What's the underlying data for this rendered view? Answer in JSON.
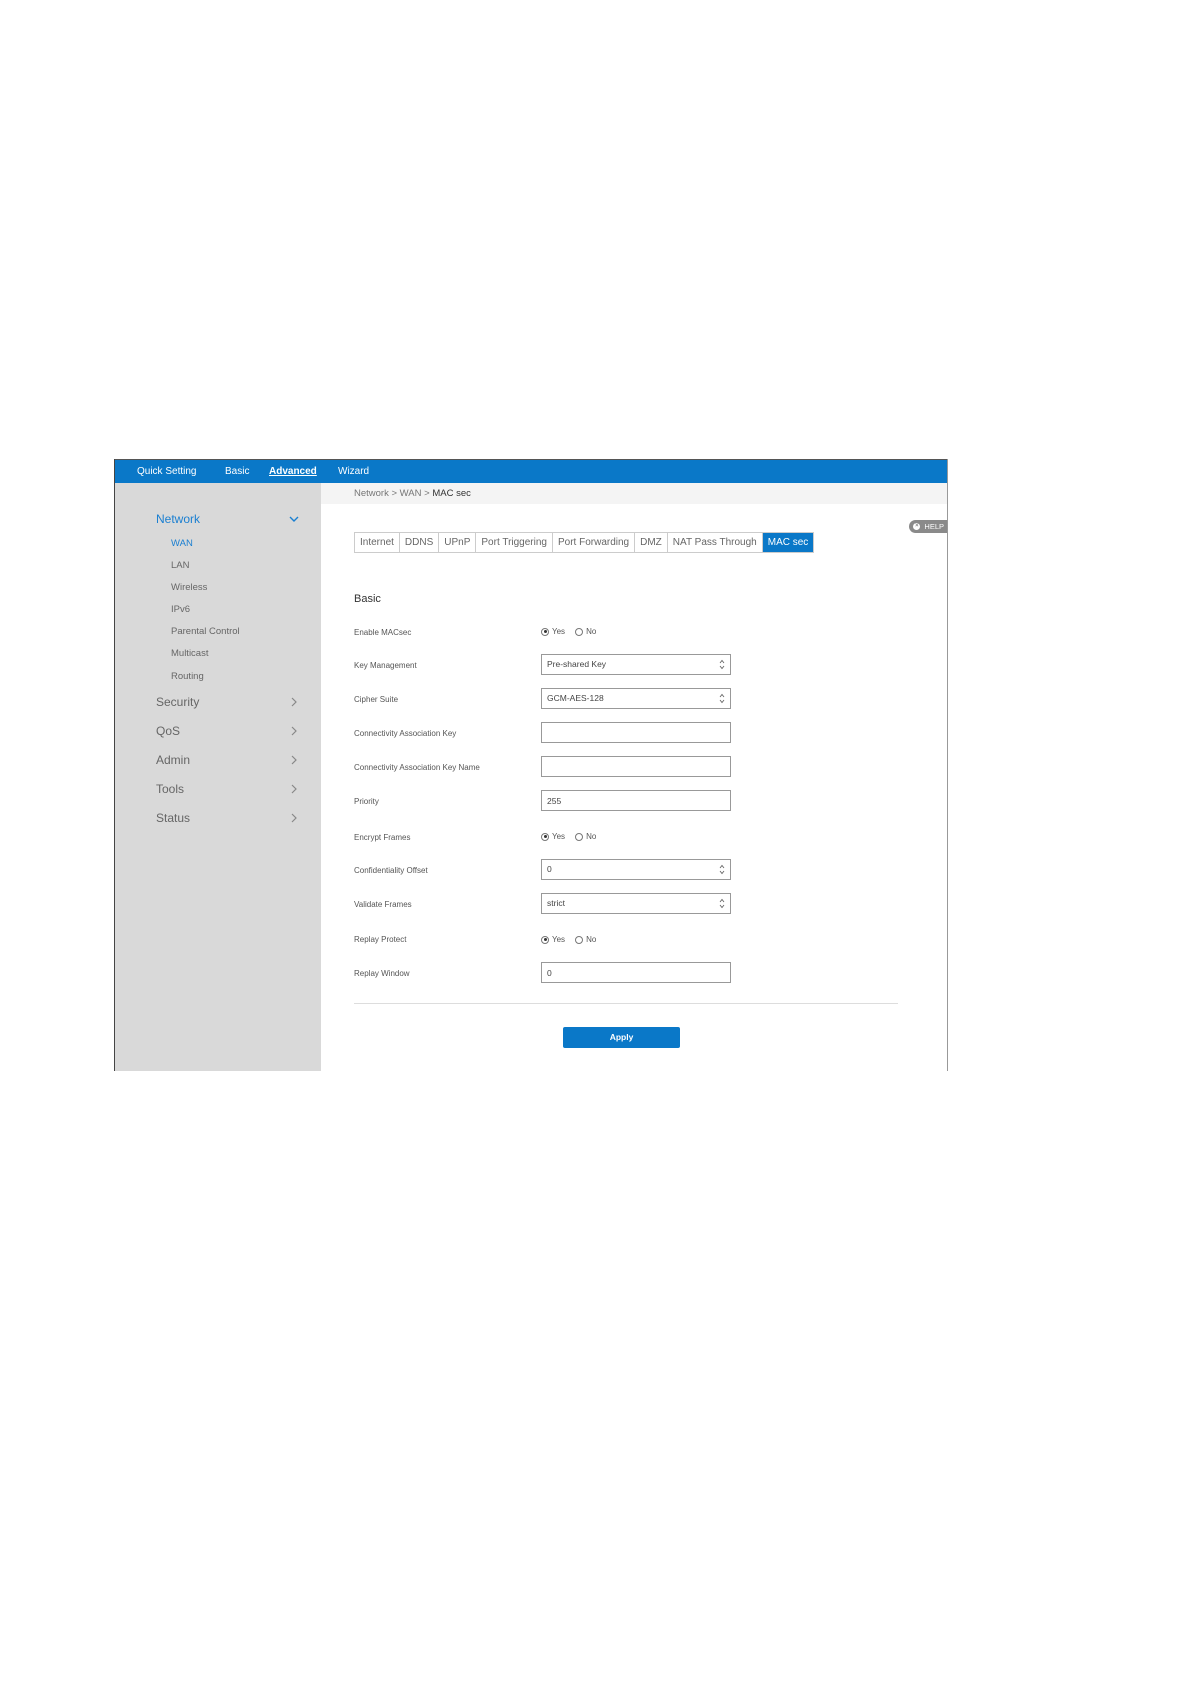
{
  "topnav": {
    "items": [
      "Quick Setting",
      "Basic",
      "Advanced",
      "Wizard"
    ],
    "active": "Advanced"
  },
  "breadcrumb": {
    "path": "Network > WAN > ",
    "current": "MAC sec"
  },
  "help_label": "HELP",
  "sidebar": {
    "network": {
      "label": "Network",
      "items": [
        "WAN",
        "LAN",
        "Wireless",
        "IPv6",
        "Parental Control",
        "Multicast",
        "Routing"
      ],
      "active": "WAN"
    },
    "groups": [
      "Security",
      "QoS",
      "Admin",
      "Tools",
      "Status"
    ]
  },
  "tabs": {
    "items": [
      "Internet",
      "DDNS",
      "UPnP",
      "Port Triggering",
      "Port Forwarding",
      "DMZ",
      "NAT Pass Through",
      "MAC sec"
    ],
    "active": "MAC sec"
  },
  "form": {
    "section_title": "Basic",
    "fields": {
      "enable_macsec": {
        "label": "Enable MACsec",
        "yes": "Yes",
        "no": "No",
        "selected": "Yes"
      },
      "key_management": {
        "label": "Key Management",
        "value": "Pre-shared Key"
      },
      "cipher_suite": {
        "label": "Cipher Suite",
        "value": "GCM-AES-128"
      },
      "cak": {
        "label": "Connectivity Association Key",
        "value": ""
      },
      "ckn": {
        "label": "Connectivity Association Key Name",
        "value": ""
      },
      "priority": {
        "label": "Priority",
        "value": "255"
      },
      "encrypt_frames": {
        "label": "Encrypt Frames",
        "yes": "Yes",
        "no": "No",
        "selected": "Yes"
      },
      "confidentiality_offset": {
        "label": "Confidentiality Offset",
        "value": "0"
      },
      "validate_frames": {
        "label": "Validate Frames",
        "value": "strict"
      },
      "replay_protect": {
        "label": "Replay Protect",
        "yes": "Yes",
        "no": "No",
        "selected": "Yes"
      },
      "replay_window": {
        "label": "Replay Window",
        "value": "0"
      }
    },
    "apply_label": "Apply"
  },
  "colors": {
    "accent": "#0a78c8",
    "sidebar_bg": "#d9d9d9",
    "active_link": "#1a7fd1"
  }
}
